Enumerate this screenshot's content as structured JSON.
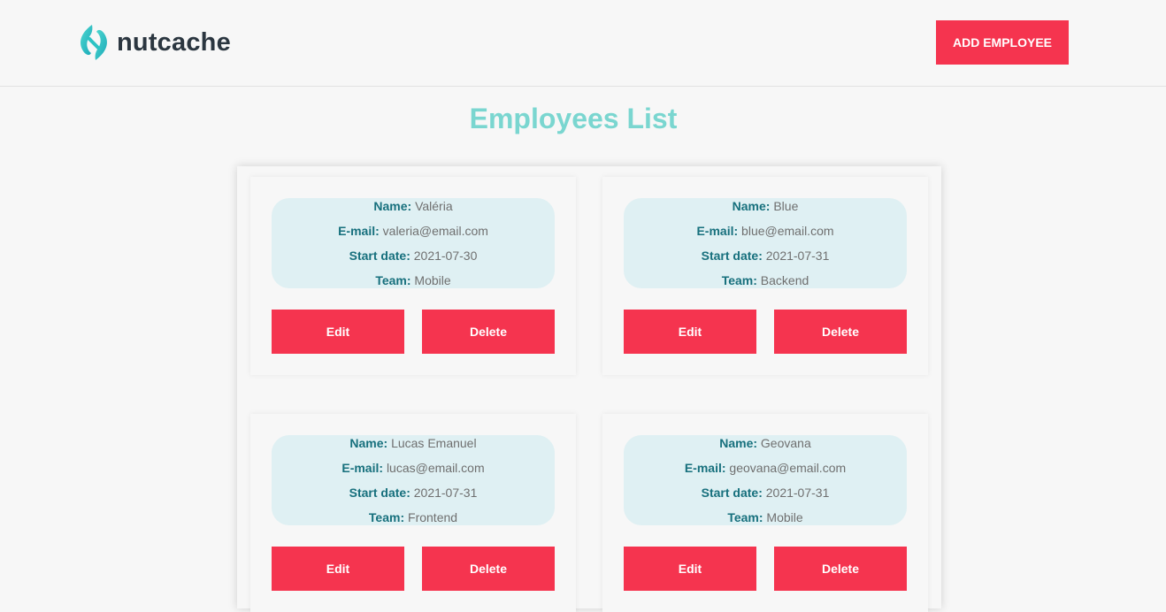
{
  "header": {
    "logo_text": "nutcache",
    "add_button_label": "ADD EMPLOYEE"
  },
  "page_title": "Employees List",
  "labels": {
    "name": "Name:",
    "email": "E-mail:",
    "start_date": "Start date:",
    "team": "Team:"
  },
  "actions": {
    "edit": "Edit",
    "delete": "Delete"
  },
  "employees": [
    {
      "name": "Valéria",
      "email": "valeria@email.com",
      "start_date": "2021-07-30",
      "team": "Mobile"
    },
    {
      "name": "Blue",
      "email": "blue@email.com",
      "start_date": "2021-07-31",
      "team": "Backend"
    },
    {
      "name": "Lucas Emanuel",
      "email": "lucas@email.com",
      "start_date": "2021-07-31",
      "team": "Frontend"
    },
    {
      "name": "Geovana",
      "email": "geovana@email.com",
      "start_date": "2021-07-31",
      "team": "Mobile"
    }
  ],
  "colors": {
    "accent": "#f5344f",
    "title": "#7ad6d0",
    "label": "#17707d",
    "info_bg": "#dff0f3",
    "background": "#f7f7f7"
  },
  "icons": {
    "logo": "nutcache-logo-icon"
  }
}
